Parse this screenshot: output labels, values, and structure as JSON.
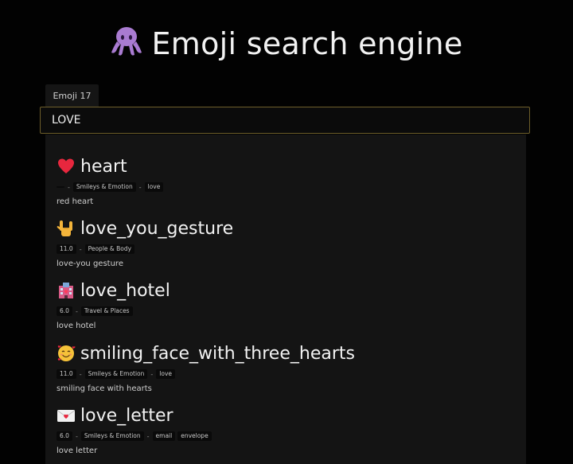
{
  "header": {
    "title": "Emoji search engine",
    "logo_icon": "octopus-icon"
  },
  "search": {
    "version_tab": "Emoji 17",
    "query": "LOVE"
  },
  "results": [
    {
      "icon": "red-heart-icon",
      "name": "heart",
      "version": "",
      "category": "Smileys & Emotion",
      "keywords": [
        "love"
      ],
      "description": "red heart"
    },
    {
      "icon": "love-you-gesture-icon",
      "name": "love_you_gesture",
      "version": "11.0",
      "category": "People & Body",
      "keywords": [],
      "description": "love-you gesture"
    },
    {
      "icon": "love-hotel-icon",
      "name": "love_hotel",
      "version": "6.0",
      "category": "Travel & Places",
      "keywords": [],
      "description": "love hotel"
    },
    {
      "icon": "smiling-face-with-hearts-icon",
      "name": "smiling_face_with_three_hearts",
      "version": "11.0",
      "category": "Smileys & Emotion",
      "keywords": [
        "love"
      ],
      "description": "smiling face with hearts"
    },
    {
      "icon": "love-letter-icon",
      "name": "love_letter",
      "version": "6.0",
      "category": "Smileys & Emotion",
      "keywords": [
        "email",
        "envelope"
      ],
      "description": "love letter"
    }
  ]
}
